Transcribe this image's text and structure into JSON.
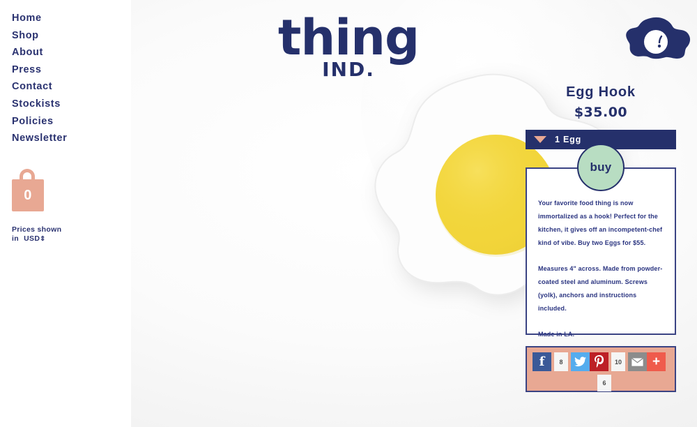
{
  "sidebar": {
    "nav": [
      {
        "label": "Home"
      },
      {
        "label": "Shop"
      },
      {
        "label": "About"
      },
      {
        "label": "Press"
      },
      {
        "label": "Contact"
      },
      {
        "label": "Stockists"
      },
      {
        "label": "Policies"
      },
      {
        "label": "Newsletter"
      }
    ],
    "bag": {
      "icon": "shopping-bag-icon",
      "count": "0"
    },
    "currency": {
      "line1": "Prices shown",
      "line2_prefix": "in",
      "value": "USD",
      "arrows": "⇕"
    }
  },
  "logo": {
    "wordmark": "thing",
    "subtitle": "IND.",
    "mark_icon": "fried-egg-blob-icon"
  },
  "product": {
    "image_alt": "egg-hook-photo",
    "title": "Egg Hook",
    "price": "$35.00",
    "variant": {
      "label": "1 Egg",
      "caret_icon": "triangle-down-icon"
    },
    "buy_label": "buy",
    "description": [
      "Your favorite food thing is now immortalized as a hook! Perfect for the kitchen, it gives off an incompetent-chef kind of vibe. Buy two Eggs for $55.",
      "Measures 4\" across. Made from powder-coated steel and aluminum. Screws (yolk), anchors and instructions included.",
      "Made in LA."
    ]
  },
  "share": {
    "facebook": {
      "icon": "facebook-icon",
      "count": "8"
    },
    "twitter": {
      "icon": "twitter-icon"
    },
    "pinterest": {
      "icon": "pinterest-icon",
      "count": "10"
    },
    "email": {
      "icon": "email-icon"
    },
    "more": {
      "icon": "plus-icon"
    },
    "total_count": "6"
  },
  "colors": {
    "navy": "#25306b",
    "salmon": "#e8a893",
    "mint": "#b8ddc2",
    "yolk": "#f2d53a",
    "plus_red": "#ef5b4c"
  }
}
